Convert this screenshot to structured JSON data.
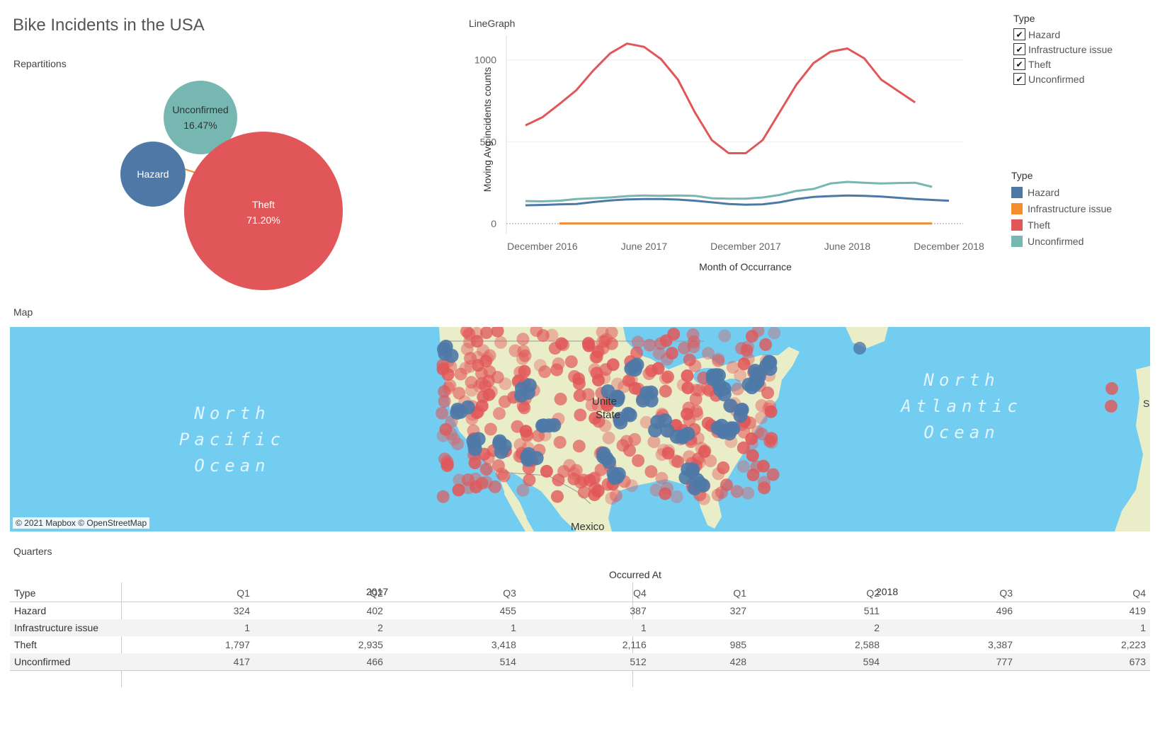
{
  "title": "Bike Incidents in the USA",
  "colors": {
    "Hazard": "#4e79a7",
    "Infrastructure issue": "#f28e2b",
    "Theft": "#e15759",
    "Unconfirmed": "#76b7b2"
  },
  "repartitions": {
    "label": "Repartitions",
    "bubbles": [
      {
        "name": "Unconfirmed",
        "pct": "16.47%"
      },
      {
        "name": "Hazard",
        "pct": ""
      },
      {
        "name": "Theft",
        "pct": "71.20%"
      }
    ]
  },
  "linegraph": {
    "label": "LineGraph"
  },
  "filter": {
    "title": "Type",
    "items": [
      {
        "label": "Hazard",
        "checked": true
      },
      {
        "label": "Infrastructure issue",
        "checked": true
      },
      {
        "label": "Theft",
        "checked": true
      },
      {
        "label": "Unconfirmed",
        "checked": true
      }
    ]
  },
  "color_legend": {
    "title": "Type",
    "items": [
      "Hazard",
      "Infrastructure issue",
      "Theft",
      "Unconfirmed"
    ]
  },
  "chart_data": [
    {
      "type": "line",
      "title": "LineGraph",
      "xlabel": "Month of Occurrance",
      "ylabel": "Moving Avg incidents counts",
      "ylim": [
        0,
        1150
      ],
      "yticks": [
        0,
        500,
        1000
      ],
      "x": [
        "2016-11",
        "2016-12",
        "2017-01",
        "2017-02",
        "2017-03",
        "2017-04",
        "2017-05",
        "2017-06",
        "2017-07",
        "2017-08",
        "2017-09",
        "2017-10",
        "2017-11",
        "2017-12",
        "2018-01",
        "2018-02",
        "2018-03",
        "2018-04",
        "2018-05",
        "2018-06",
        "2018-07",
        "2018-08",
        "2018-09",
        "2018-10",
        "2018-11",
        "2018-12"
      ],
      "xtick_labels": [
        {
          "x": "2016-12",
          "label": "December 2016"
        },
        {
          "x": "2017-06",
          "label": "June 2017"
        },
        {
          "x": "2017-12",
          "label": "December 2017"
        },
        {
          "x": "2018-06",
          "label": "June 2018"
        },
        {
          "x": "2018-12",
          "label": "December 2018"
        }
      ],
      "series": [
        {
          "name": "Hazard",
          "values": [
            112,
            114,
            118,
            120,
            132,
            142,
            148,
            150,
            150,
            147,
            140,
            130,
            120,
            116,
            118,
            130,
            150,
            163,
            168,
            172,
            170,
            165,
            158,
            150,
            145,
            140
          ]
        },
        {
          "name": "Infrastructure issue",
          "values": [
            null,
            null,
            1,
            1,
            1,
            1,
            1,
            1,
            1,
            1,
            1,
            1,
            1,
            1,
            1,
            1,
            1,
            1,
            1,
            1,
            1,
            1,
            1,
            1,
            1,
            null
          ]
        },
        {
          "name": "Theft",
          "values": [
            600,
            650,
            730,
            815,
            935,
            1040,
            1100,
            1080,
            1005,
            880,
            680,
            510,
            430,
            430,
            510,
            680,
            850,
            980,
            1050,
            1070,
            1010,
            880,
            810,
            740,
            null,
            null
          ]
        },
        {
          "name": "Unconfirmed",
          "values": [
            138,
            136,
            140,
            150,
            155,
            160,
            168,
            172,
            170,
            172,
            170,
            155,
            152,
            152,
            160,
            175,
            200,
            212,
            245,
            255,
            250,
            245,
            248,
            250,
            225,
            null
          ]
        }
      ],
      "grid": "horizontal",
      "legend": "right"
    },
    {
      "type": "table",
      "title": "Quarters",
      "column_header": "Occurred At",
      "row_header": "Type",
      "years": [
        "2017",
        "2018"
      ],
      "quarters": [
        "Q1",
        "Q2",
        "Q3",
        "Q4",
        "Q1",
        "Q2",
        "Q3",
        "Q4"
      ],
      "rows": [
        {
          "type": "Hazard",
          "values": [
            "324",
            "402",
            "455",
            "387",
            "327",
            "511",
            "496",
            "419"
          ]
        },
        {
          "type": "Infrastructure issue",
          "values": [
            "1",
            "2",
            "1",
            "1",
            "",
            "2",
            "",
            "1"
          ]
        },
        {
          "type": "Theft",
          "values": [
            "1,797",
            "2,935",
            "3,418",
            "2,116",
            "985",
            "2,588",
            "3,387",
            "2,223"
          ]
        },
        {
          "type": "Unconfirmed",
          "values": [
            "417",
            "466",
            "514",
            "512",
            "428",
            "594",
            "777",
            "673"
          ]
        }
      ]
    }
  ],
  "map": {
    "label": "Map",
    "credit": "© 2021 Mapbox © OpenStreetMap",
    "ocean_pacific": [
      "North",
      "Pacific",
      "Ocean"
    ],
    "ocean_atlantic": [
      "North",
      "Atlantic",
      "Ocean"
    ],
    "place_us": [
      "Unite",
      "State"
    ],
    "place_mexico": "Mexico",
    "place_edge": "S"
  },
  "quarters": {
    "label": "Quarters"
  }
}
